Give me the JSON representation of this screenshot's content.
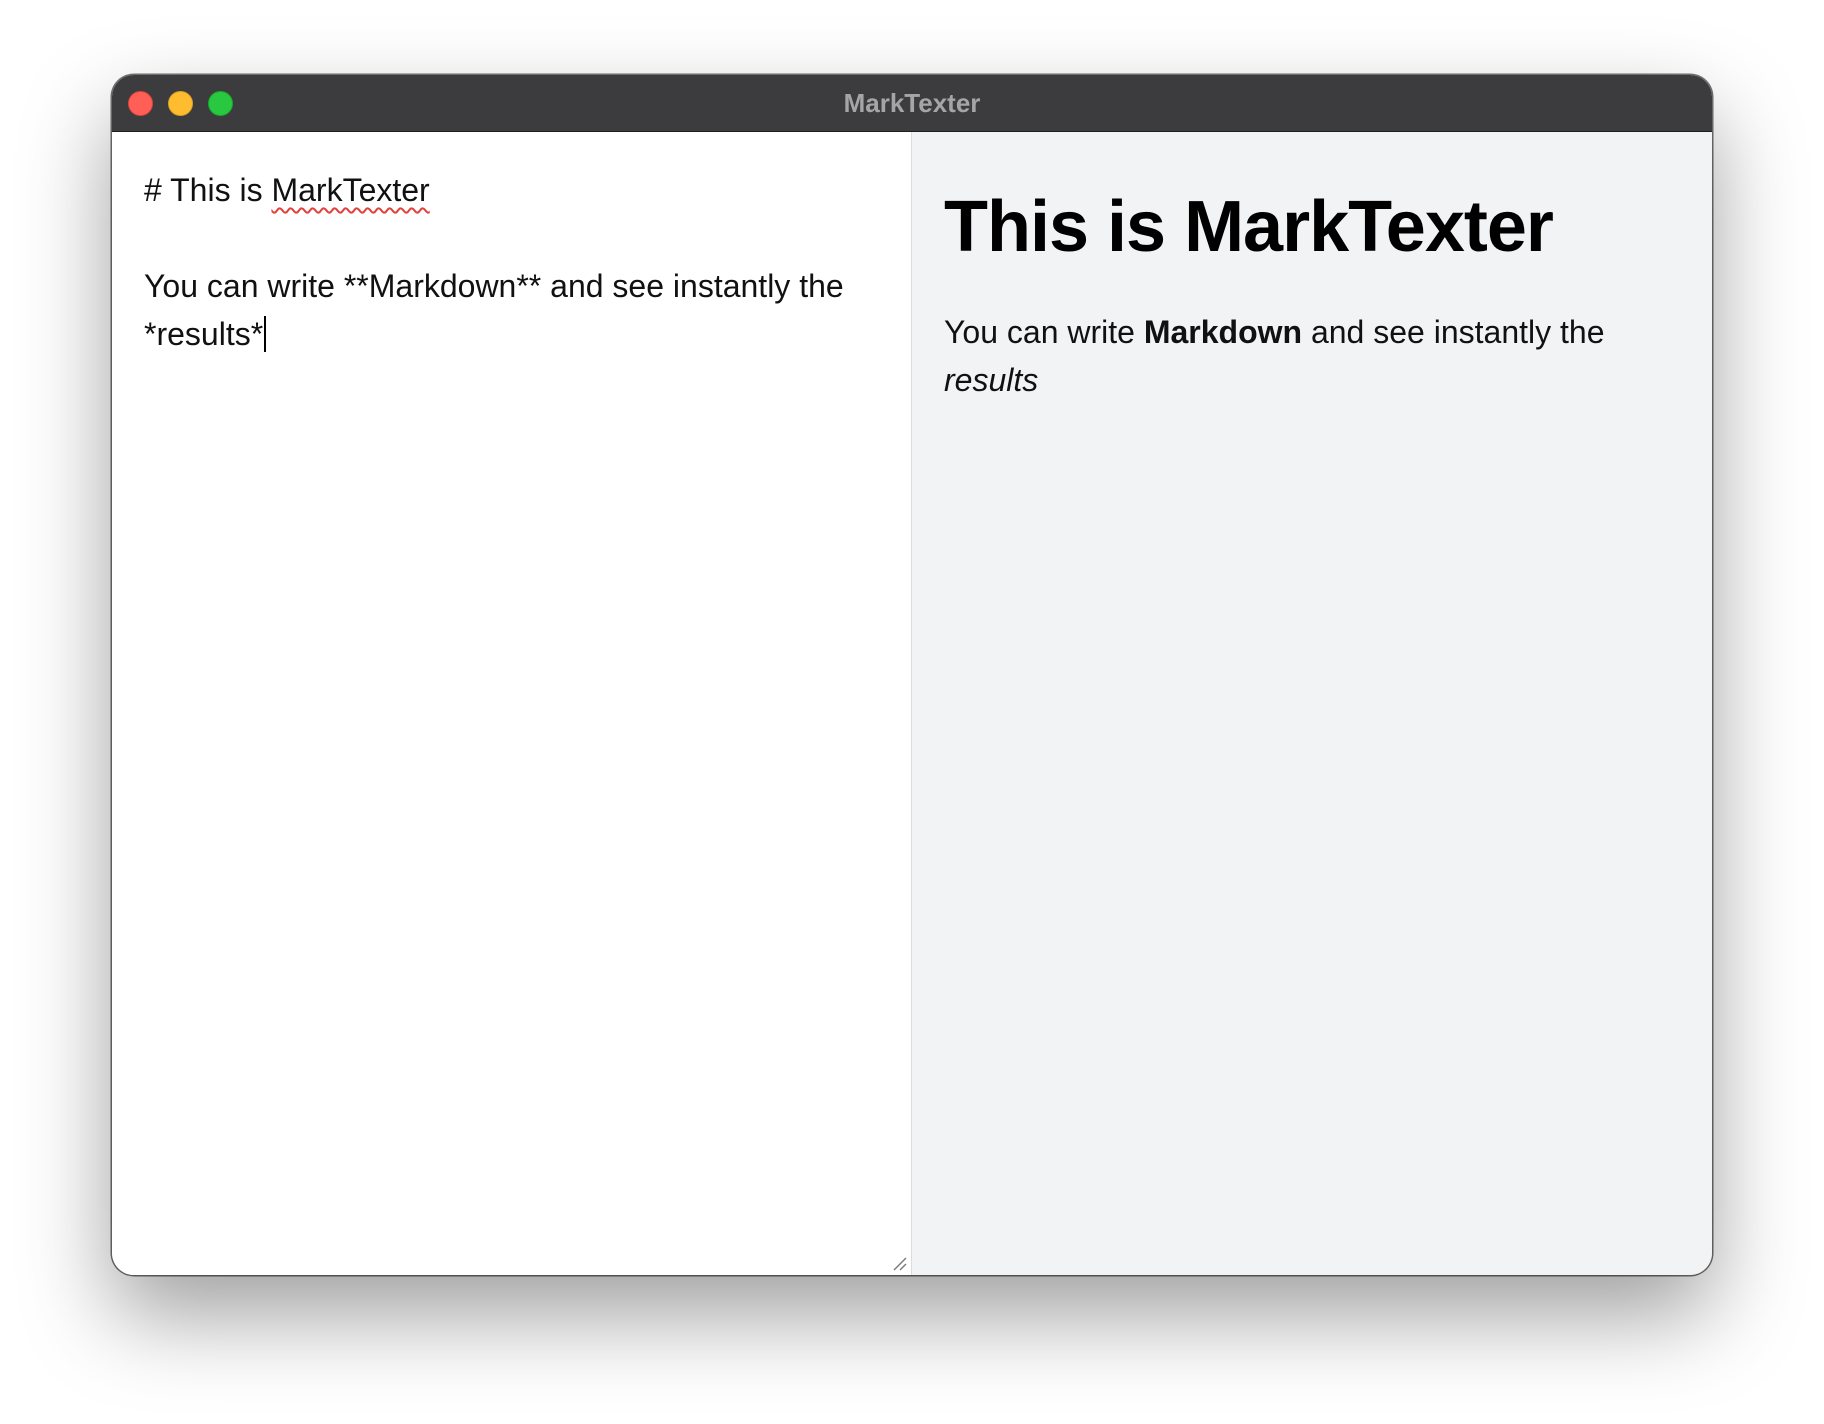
{
  "window": {
    "title": "MarkTexter"
  },
  "editor": {
    "heading_line": "# This is ",
    "heading_misspelled_word": "MarkTexter",
    "body_line": "You can write **Markdown** and see instantly the *results*"
  },
  "preview": {
    "heading": "This is MarkTexter",
    "paragraph": {
      "before": "You can write ",
      "bold": "Markdown",
      "middle": " and see instantly the ",
      "italic": "results"
    }
  },
  "colors": {
    "titlebar": "#3c3c3e",
    "close": "#ff5f57",
    "minimize": "#febc2e",
    "zoom": "#28c840",
    "preview_background": "#f2f3f5",
    "spellcheck_underline": "#e0413a"
  }
}
